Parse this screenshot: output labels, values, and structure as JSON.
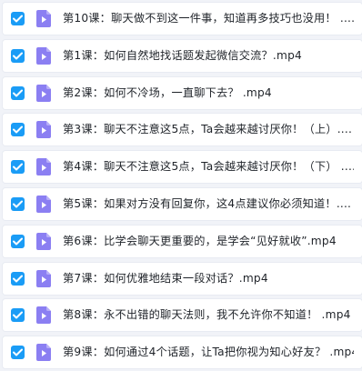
{
  "file_list": {
    "items": [
      {
        "name": "第10课：聊天做不到这一件事，知道再多技巧也没用！ ....",
        "checked": true
      },
      {
        "name": "第1课：如何自然地找话题发起微信交流？.mp4",
        "checked": true
      },
      {
        "name": "第2课：如何不冷场，一直聊下去？ .mp4",
        "checked": true
      },
      {
        "name": "第3课：聊天不注意这5点，Ta会越来越讨厌你！（上）....",
        "checked": true
      },
      {
        "name": "第4课：聊天不注意这5点，Ta会越来越讨厌你！（下） ....",
        "checked": true
      },
      {
        "name": "第5课：如果对方没有回复你，这4点建议你必须知道！....",
        "checked": true
      },
      {
        "name": "第6课：比学会聊天更重要的，是学会“见好就收”.mp4",
        "checked": true
      },
      {
        "name": "第7课：如何优雅地结束一段对话？.mp4",
        "checked": true
      },
      {
        "name": "第8课：永不出错的聊天法则，我不允许你不知道！ .mp4",
        "checked": true
      },
      {
        "name": "第9课：如何通过4个话题，让Ta把你视为知心好友？ .mp4",
        "checked": true
      }
    ]
  },
  "icons": {
    "checkbox": "checkbox-checked-icon",
    "file": "video-file-icon"
  },
  "colors": {
    "checkbox": "#1a9cf6",
    "file_icon": "#8b7ff2",
    "background": "#f1f3f8"
  }
}
